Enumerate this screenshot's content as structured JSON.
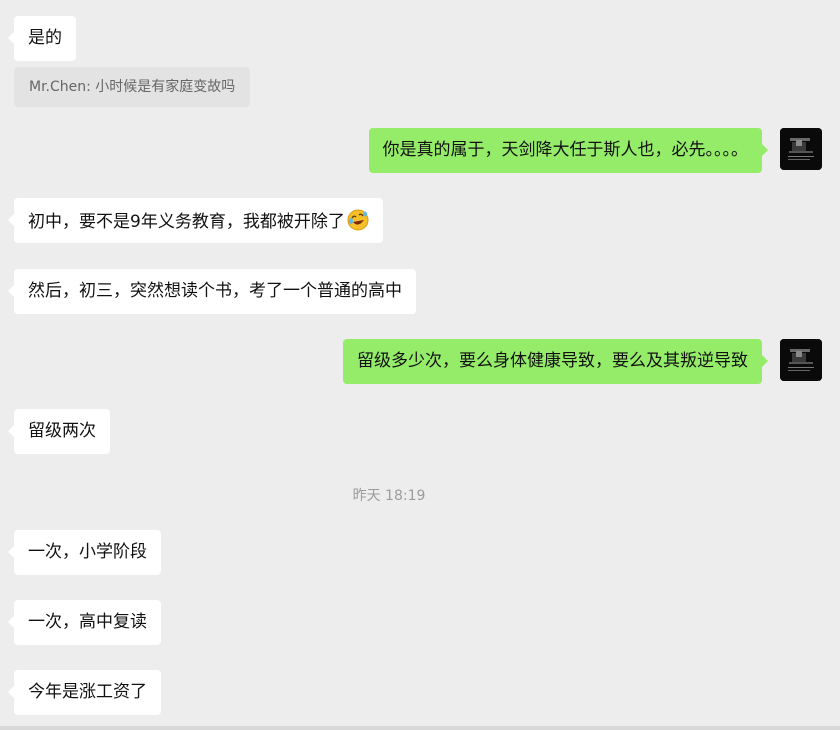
{
  "messages": [
    {
      "type": "in",
      "text": "是的"
    },
    {
      "type": "quote",
      "text": "Mr.Chen: 小时候是有家庭变故吗"
    },
    {
      "type": "out",
      "text": "你是真的属于，天剑降大任于斯人也，必先。。。。"
    },
    {
      "type": "in",
      "text": "初中，要不是9年义务教育，我都被开除了",
      "emoji": "rolling-on-floor-laughing-emoji"
    },
    {
      "type": "in",
      "text": "然后，初三，突然想读个书，考了一个普通的高中"
    },
    {
      "type": "out",
      "text": "留级多少次，要么身体健康导致，要么及其叛逆导致"
    },
    {
      "type": "in",
      "text": "留级两次"
    },
    {
      "type": "timestamp",
      "text": "昨天 18:19"
    },
    {
      "type": "in",
      "text": "一次，小学阶段"
    },
    {
      "type": "in",
      "text": "一次，高中复读"
    },
    {
      "type": "in",
      "text": "今年是涨工资了"
    }
  ],
  "colors": {
    "background": "#ededed",
    "incoming_bubble": "#ffffff",
    "outgoing_bubble": "#95ec69",
    "quote_bubble": "#e3e3e3",
    "timestamp_text": "#9c9c9c"
  }
}
